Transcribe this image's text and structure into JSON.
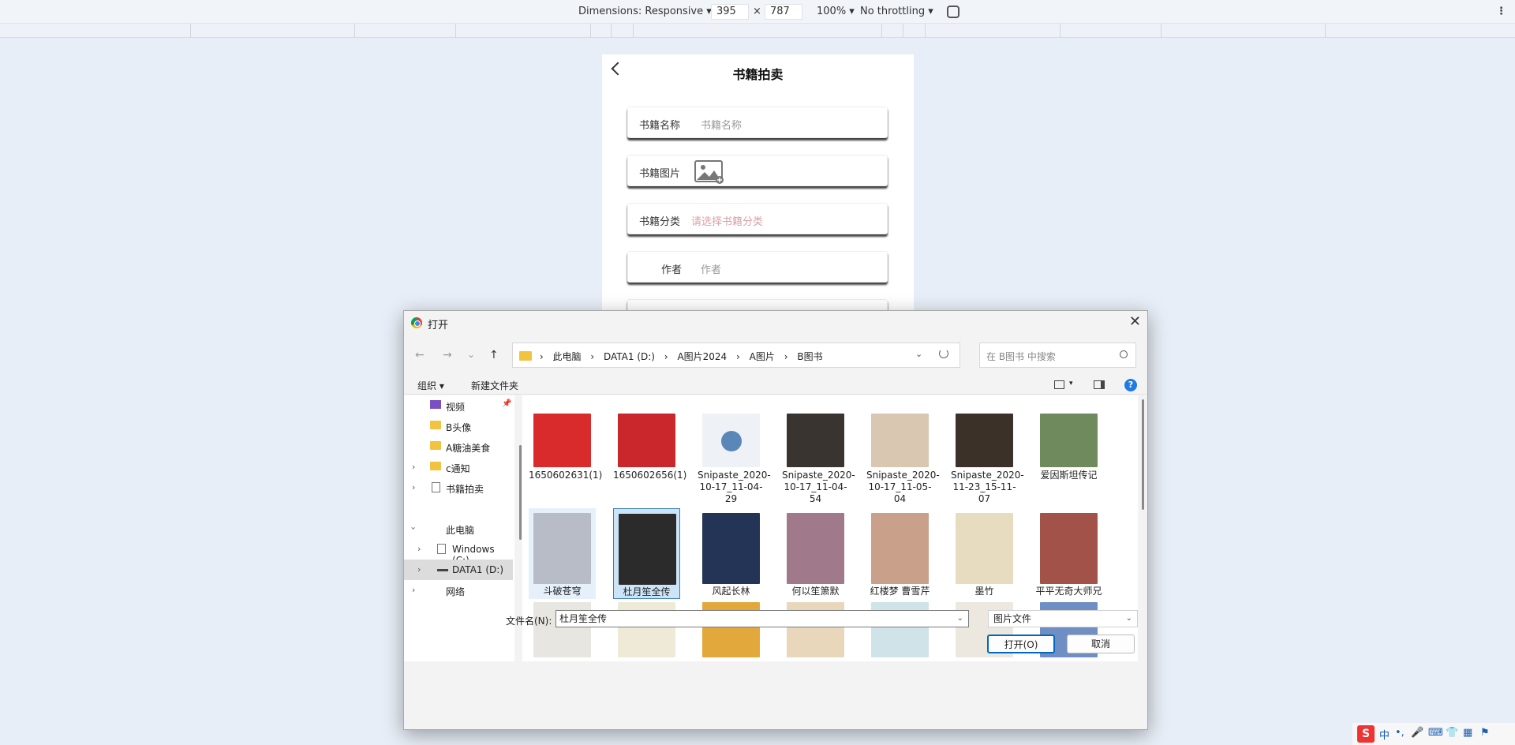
{
  "devtools": {
    "dimensions_label": "Dimensions: Responsive ▾",
    "width": "395",
    "times": "×",
    "height": "787",
    "zoom": "100% ▾",
    "throttle": "No throttling ▾",
    "more": "⋮"
  },
  "app": {
    "title": "书籍拍卖",
    "fields": [
      {
        "label": "书籍名称",
        "value": "书籍名称"
      },
      {
        "label": "书籍图片",
        "value": ""
      },
      {
        "label": "书籍分类",
        "value": "请选择书籍分类"
      },
      {
        "label": "作者",
        "value": "作者"
      }
    ]
  },
  "dialog": {
    "title": "打开",
    "close": "✕",
    "nav": {
      "back": "←",
      "forward": "→",
      "recent": "⌄",
      "up": "↑"
    },
    "breadcrumb": [
      "此电脑",
      "DATA1 (D:)",
      "A图片2024",
      "A图片",
      "B图书"
    ],
    "breadcrumb_sep": "›",
    "search_placeholder": "在 B图书 中搜索",
    "toolbar": {
      "organize": "组织 ▾",
      "new_folder": "新建文件夹",
      "help": "?"
    },
    "sidebar": [
      {
        "label": "视频",
        "icon": "video-icon"
      },
      {
        "label": "B头像",
        "icon": "folder-icon"
      },
      {
        "label": "A糖油美食",
        "icon": "folder-icon"
      },
      {
        "label": "c通知",
        "icon": "folder-icon"
      },
      {
        "label": "书籍拍卖",
        "icon": "file-icon"
      },
      {
        "label": "此电脑",
        "icon": "pc-icon"
      },
      {
        "label": "Windows (C:)",
        "icon": "drive-icon"
      },
      {
        "label": "DATA1 (D:)",
        "icon": "drive-icon"
      },
      {
        "label": "网络",
        "icon": "network-icon"
      }
    ],
    "files": [
      {
        "name": "1650602631(1)",
        "color": "#d92b2b"
      },
      {
        "name": "1650602656(1)",
        "color": "#c9272c"
      },
      {
        "name": "Snipaste_2020-10-17_11-04-29",
        "color": "#eef1f5"
      },
      {
        "name": "Snipaste_2020-10-17_11-04-54",
        "color": "#3a3430"
      },
      {
        "name": "Snipaste_2020-10-17_11-05-04",
        "color": "#d9c7b2"
      },
      {
        "name": "Snipaste_2020-11-23_15-11-07",
        "color": "#3b3129"
      },
      {
        "name": "爱因斯坦传记",
        "color": "#6f8b5e"
      },
      {
        "name": "斗破苍穹",
        "color": "#b8bcc6"
      },
      {
        "name": "杜月笙全传",
        "color": "#2b2b2b"
      },
      {
        "name": "风起长林",
        "color": "#233456"
      },
      {
        "name": "何以笙箫默",
        "color": "#a07a8a"
      },
      {
        "name": "红楼梦 曹雪芹",
        "color": "#c9a18a"
      },
      {
        "name": "墨竹",
        "color": "#e8dcc0"
      },
      {
        "name": "平平无奇大师兄",
        "color": "#a3524a"
      },
      {
        "name": "",
        "color": "#e8e6e0"
      },
      {
        "name": "",
        "color": "#efe9d8"
      },
      {
        "name": "",
        "color": "#e2a83c"
      },
      {
        "name": "",
        "color": "#e9d7bb"
      },
      {
        "name": "",
        "color": "#cfe3e8"
      },
      {
        "name": "",
        "color": "#ece8e0"
      },
      {
        "name": "",
        "color": "#6f8fc4"
      }
    ],
    "file_name_label": "文件名(N):",
    "file_name_value": "杜月笙全传",
    "file_type": "图片文件",
    "open_button": "打开(O)",
    "cancel_button": "取消"
  },
  "tray": {
    "ime": "S",
    "items": [
      "中",
      "•,",
      "🎤",
      "⌨",
      "👕",
      "▦",
      "⚑"
    ]
  }
}
